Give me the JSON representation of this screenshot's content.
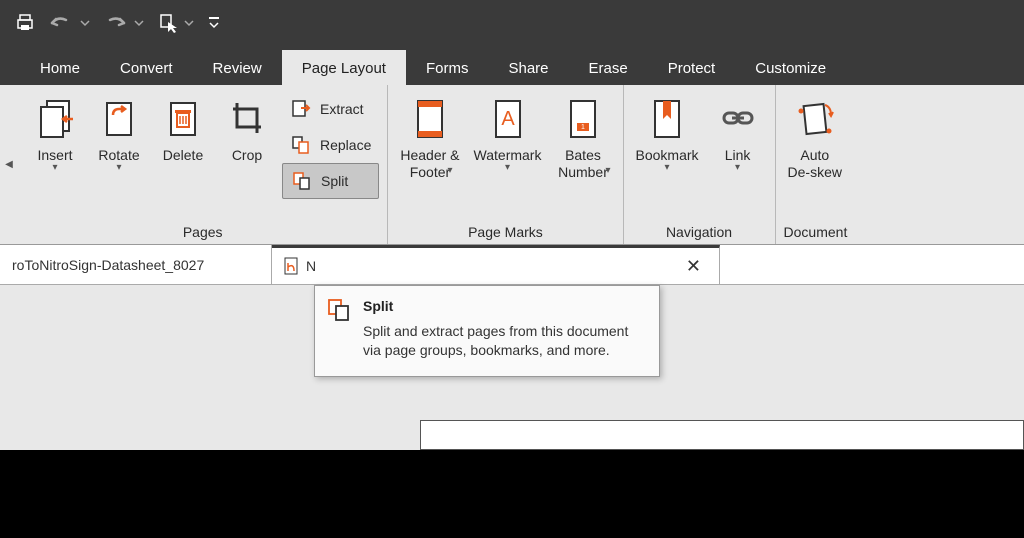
{
  "qat": {},
  "tabs": [
    "Home",
    "Convert",
    "Review",
    "Page Layout",
    "Forms",
    "Share",
    "Erase",
    "Protect",
    "Customize"
  ],
  "ribbon": {
    "pages": {
      "label": "Pages",
      "insert": "Insert",
      "rotate": "Rotate",
      "delete": "Delete",
      "crop": "Crop",
      "extract": "Extract",
      "replace": "Replace",
      "split": "Split"
    },
    "pageMarks": {
      "label": "Page Marks",
      "headerFooter": "Header &\nFooter",
      "watermark": "Watermark",
      "bates": "Bates\nNumber"
    },
    "navigation": {
      "label": "Navigation",
      "bookmark": "Bookmark",
      "link": "Link"
    },
    "document": {
      "label": "Document",
      "autoDeskew": "Auto\nDe-skew"
    }
  },
  "docTabs": {
    "first": "roToNitroSign-Datasheet_8027",
    "second": "N"
  },
  "tooltip": {
    "title": "Split",
    "desc": "Split and extract pages from this document via page groups, bookmarks, and more."
  }
}
